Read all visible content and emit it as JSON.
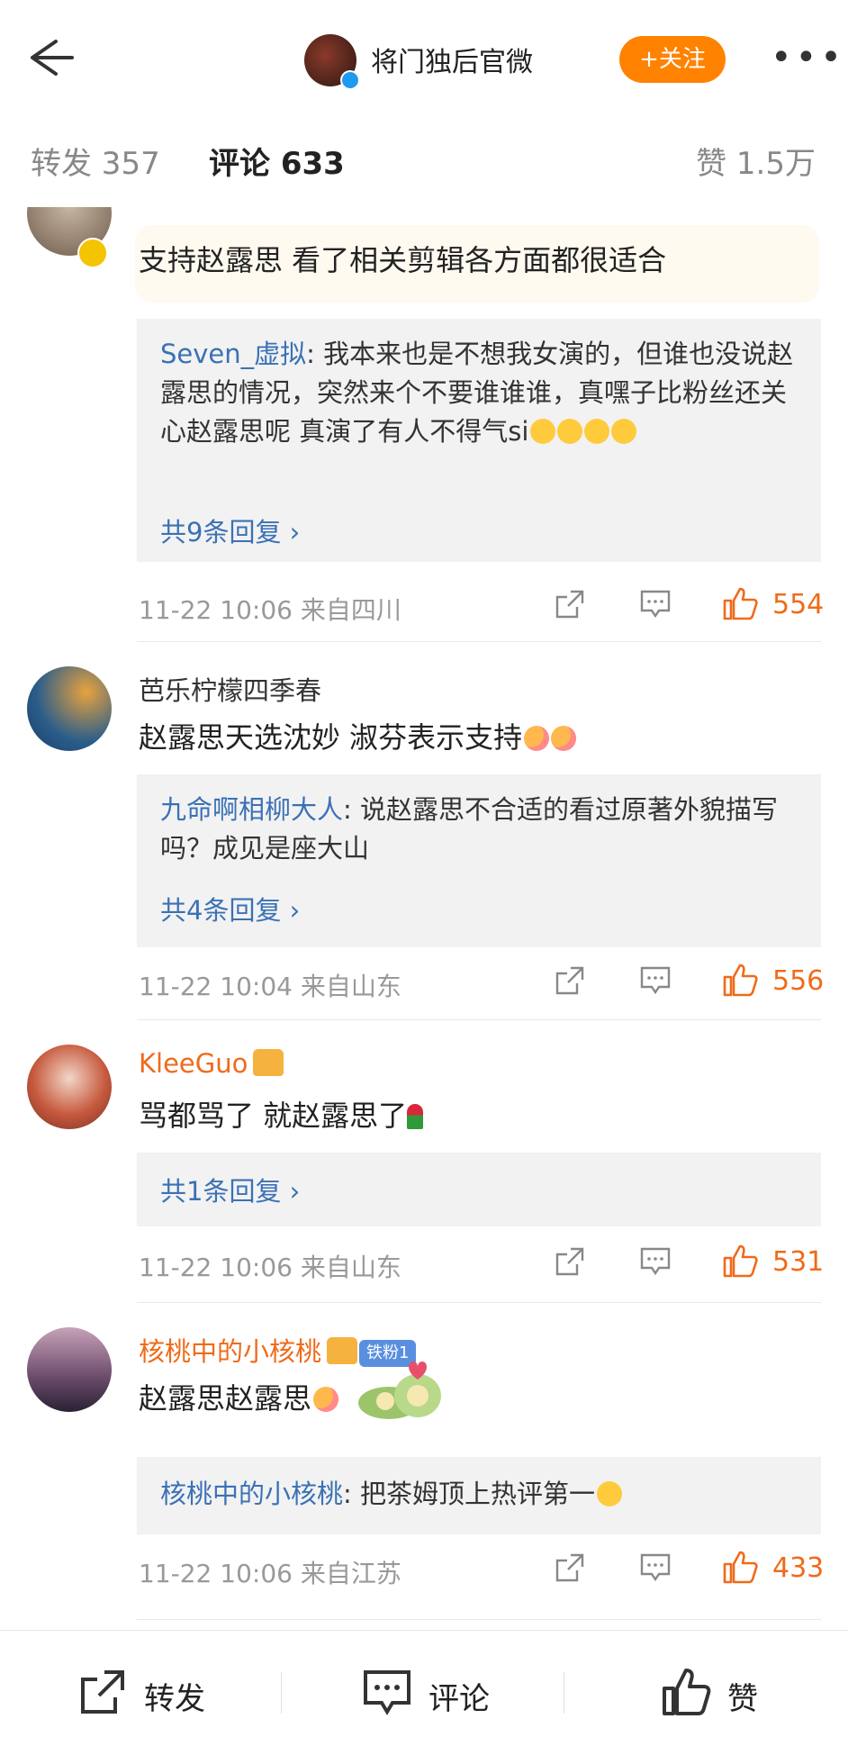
{
  "header": {
    "title": "将门独后官微",
    "follow_label": "+关注"
  },
  "tabs": {
    "forward": "转发 357",
    "comments": "评论 633",
    "likes": "赞 1.5万"
  },
  "comments": [
    {
      "text": "支持赵露思 看了相关剪辑各方面都很适合",
      "reply_author": "Seven_虚拟",
      "reply_text": ": 我本来也是不想我女演的，但谁也没说赵露思的情况，突然来个不要谁谁谁，真嘿子比粉丝还关心赵露思呢 真演了有人不得气si",
      "reply_more": "共9条回复 ›",
      "meta": "11-22 10:06 来自四川",
      "likes": "554"
    },
    {
      "name": "芭乐柠檬四季春",
      "text": "赵露思天选沈妙 淑芬表示支持",
      "reply_author": "九命啊相柳大人",
      "reply_text": ": 说赵露思不合适的看过原著外貌描写吗？成见是座大山",
      "reply_more": "共4条回复 ›",
      "meta": "11-22 10:04 来自山东",
      "likes": "556"
    },
    {
      "name": "KleeGuo",
      "text": "骂都骂了 就赵露思了",
      "reply_more": "共1条回复 ›",
      "meta": "11-22 10:06 来自山东",
      "likes": "531"
    },
    {
      "name": "核桃中的小核桃",
      "badge": "铁粉1",
      "text": "赵露思赵露思",
      "reply_author": "核桃中的小核桃",
      "reply_text": ": 把茶姆顶上热评第一",
      "meta": "11-22 10:06 来自江苏",
      "likes": "433"
    }
  ],
  "bottom_bar": {
    "forward": "转发",
    "comment": "评论",
    "like": "赞"
  },
  "colors": {
    "accent": "#ff8200",
    "link": "#3b71b5",
    "like": "#ef6b1a"
  }
}
